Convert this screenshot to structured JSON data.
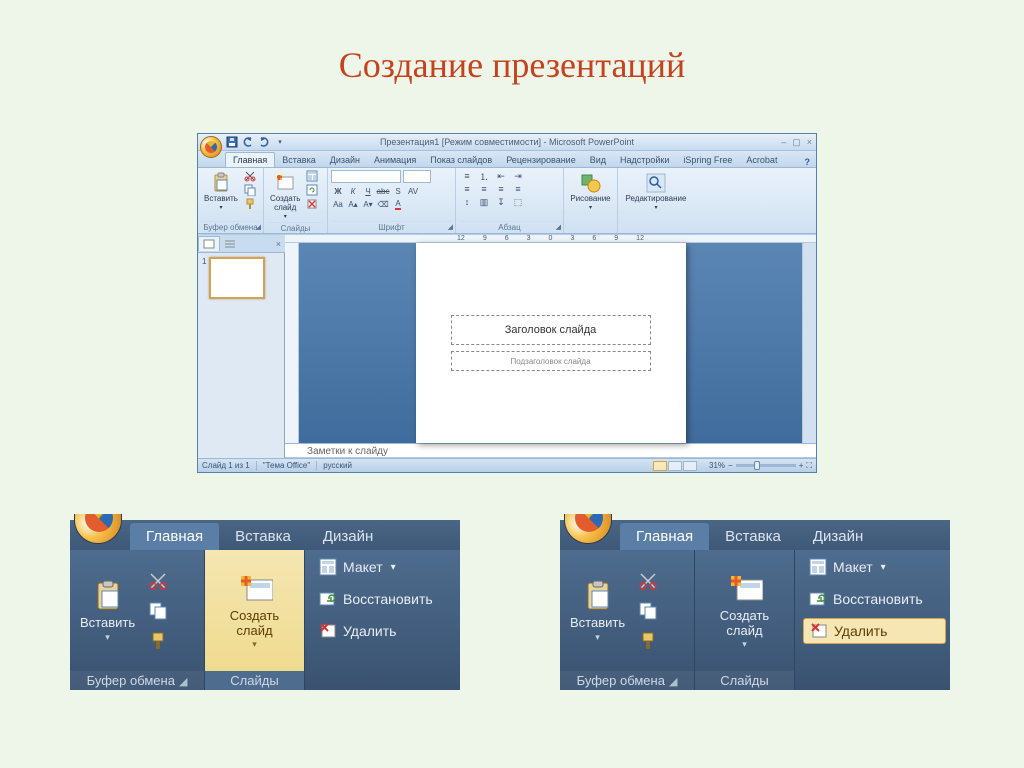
{
  "page": {
    "title": "Создание презентаций"
  },
  "window": {
    "title": "Презентация1 [Режим совместимости] - Microsoft PowerPoint",
    "tabs": [
      "Главная",
      "Вставка",
      "Дизайн",
      "Анимация",
      "Показ слайдов",
      "Рецензирование",
      "Вид",
      "Надстройки",
      "iSpring Free",
      "Acrobat"
    ],
    "active_tab": 0,
    "groups": {
      "clipboard": {
        "label": "Буфер обмена",
        "paste": "Вставить"
      },
      "slides": {
        "label": "Слайды",
        "new_slide": "Создать\nслайд"
      },
      "font": {
        "label": "Шрифт"
      },
      "paragraph": {
        "label": "Абзац"
      },
      "drawing": {
        "label": "Рисование"
      },
      "editing": {
        "label": "Редактирование"
      }
    },
    "ruler": [
      "12",
      "9",
      "6",
      "3",
      "0",
      "3",
      "6",
      "9",
      "12"
    ],
    "slide": {
      "title_ph": "Заголовок слайда",
      "subtitle_ph": "Подзаголовок слайда"
    },
    "notes": "Заметки к слайду",
    "status": {
      "slide_of": "Слайд 1 из 1",
      "theme": "\"Тема Office\"",
      "lang": "русский",
      "zoom": "31%"
    }
  },
  "detail": {
    "tabs": [
      "Главная",
      "Вставка",
      "Дизайн"
    ],
    "clipboard_label": "Буфер обмена",
    "paste": "Вставить",
    "new_slide": "Создать\nслайд",
    "slides_label": "Слайды",
    "layout": "Макет",
    "reset": "Восстановить",
    "delete": "Удалить"
  }
}
